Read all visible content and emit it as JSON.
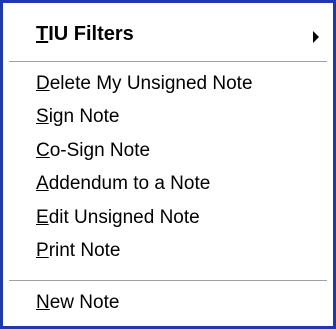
{
  "menu": {
    "header": {
      "mnemonic": "T",
      "rest": "IU Filters"
    },
    "items": [
      {
        "mnemonic": "D",
        "rest": "elete My Unsigned Note"
      },
      {
        "mnemonic": "S",
        "rest": "ign Note"
      },
      {
        "mnemonic": "C",
        "rest": "o-Sign Note"
      },
      {
        "mnemonic": "A",
        "rest": "ddendum to a Note"
      },
      {
        "mnemonic": "E",
        "rest": "dit Unsigned Note"
      },
      {
        "mnemonic": "P",
        "rest": "rint Note"
      }
    ],
    "footer": {
      "mnemonic": "N",
      "rest": "ew Note"
    },
    "submenu_indicator_icon": "triangle-right-icon",
    "border_color": "#1f3aa8"
  }
}
